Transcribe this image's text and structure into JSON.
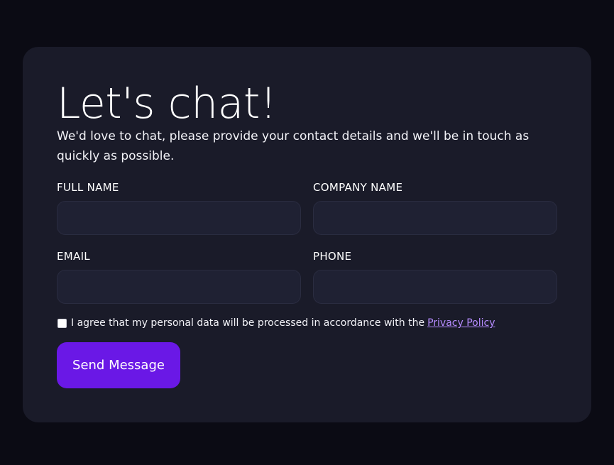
{
  "form": {
    "title": "Let's chat!",
    "subtitle": "We'd love to chat, please provide your contact details and we'll be in touch as quickly as possible.",
    "fields": [
      {
        "label": "FULL NAME",
        "value": "",
        "placeholder": ""
      },
      {
        "label": "COMPANY NAME",
        "value": "",
        "placeholder": ""
      },
      {
        "label": "EMAIL",
        "value": "",
        "placeholder": ""
      },
      {
        "label": "PHONE",
        "value": "",
        "placeholder": ""
      }
    ],
    "consent": {
      "text": "I agree that my personal data will be processed in accordance with the",
      "link_text": "Privacy Policy",
      "checked": false
    },
    "submit_label": "Send Message"
  },
  "colors": {
    "background": "#0b0b14",
    "card": "#1a1b29",
    "input": "#1f2133",
    "accent": "#6a18e6",
    "link": "#b68cff"
  }
}
